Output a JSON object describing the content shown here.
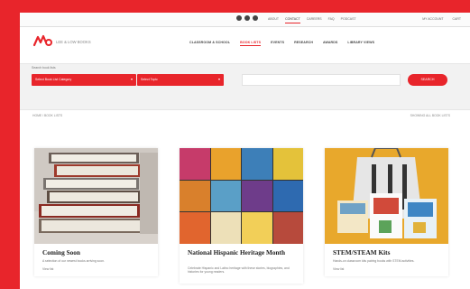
{
  "utility_bar": {
    "links": [
      "ABOUT",
      "CONTACT",
      "CAREERS",
      "FAQ",
      "PODCAST"
    ],
    "active_index": 1,
    "account": "MY ACCOUNT",
    "cart": "CART"
  },
  "header": {
    "logo_text": "LEE & LOW BOOKS",
    "nav": [
      "CLASSROOM & SCHOOL",
      "BOOK LISTS",
      "EVENTS",
      "RESEARCH",
      "AWARDS",
      "LIBRARY VIEWS"
    ],
    "active_index": 1
  },
  "search": {
    "label": "Search book lists",
    "category_select": "Select Book List Category",
    "subcategory_select": "Select Topic",
    "keyword_placeholder": "",
    "button_label": "SEARCH"
  },
  "breadcrumb": "HOME / BOOK LISTS",
  "breadcrumb_right": "SHOWING ALL BOOK LISTS",
  "cards": [
    {
      "title": "Coming Soon",
      "description": "A selection of our newest books arriving soon.",
      "more": "View list"
    },
    {
      "title": "National Hispanic Heritage Month",
      "description": "Celebrate Hispanic and Latino heritage with these stories, biographies, and histories for young readers.",
      "more": "View list"
    },
    {
      "title": "STEM/STEAM Kits",
      "description": "Hands-on classroom kits pairing books with STEM activities.",
      "more": "View list"
    }
  ],
  "colors": {
    "brand_red": "#e8252b"
  }
}
